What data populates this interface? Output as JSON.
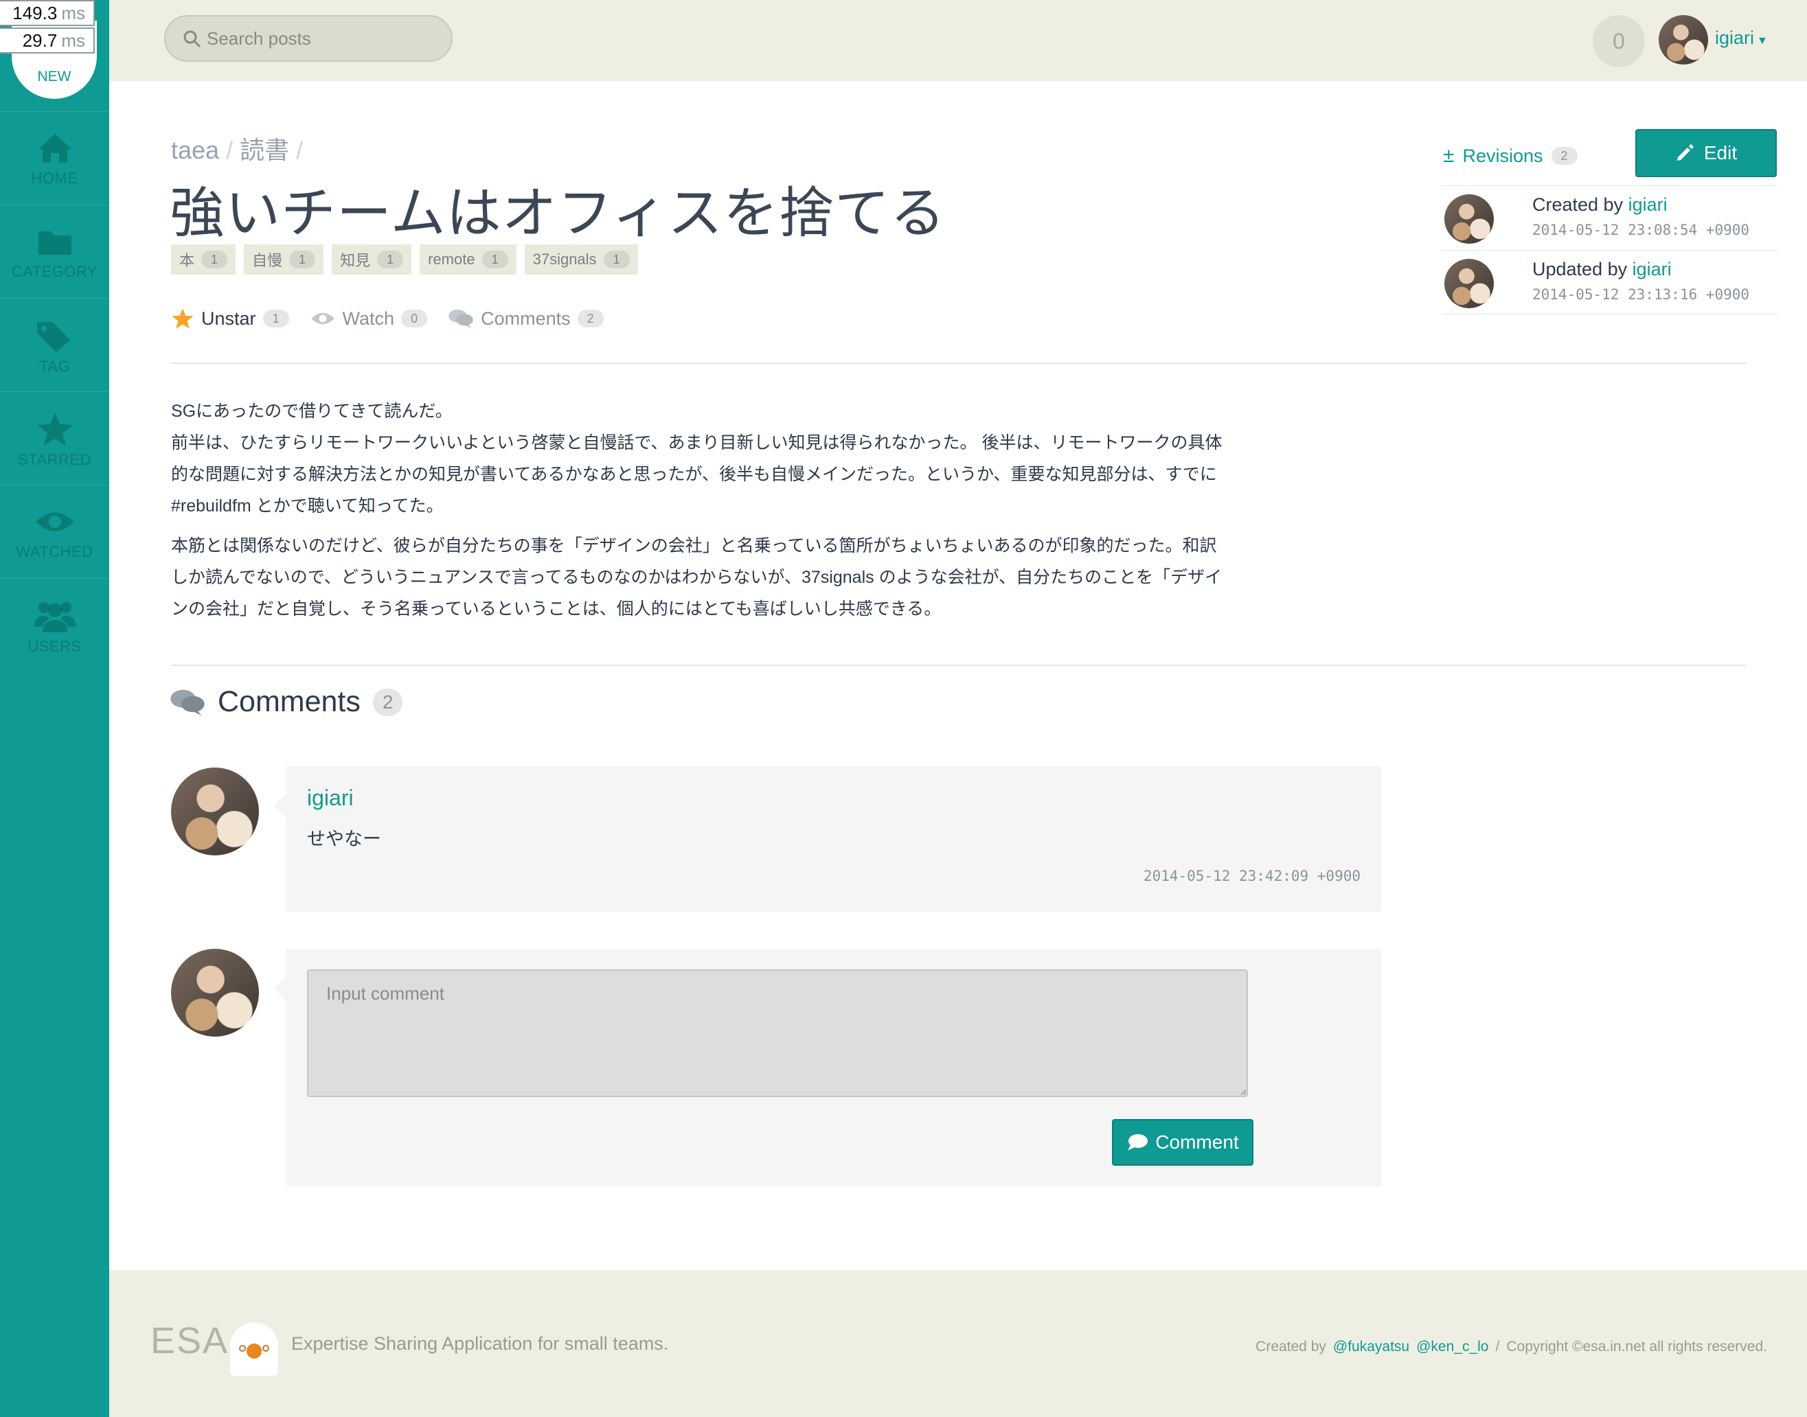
{
  "perf": {
    "top_value": "149.3",
    "bottom_value": "29.7",
    "unit": "ms"
  },
  "sidebar": {
    "new_label": "NEW",
    "items": [
      {
        "label": "HOME",
        "icon": "home-icon"
      },
      {
        "label": "CATEGORY",
        "icon": "folder-icon"
      },
      {
        "label": "TAG",
        "icon": "tags-icon"
      },
      {
        "label": "STARRED",
        "icon": "star-icon"
      },
      {
        "label": "WATCHED",
        "icon": "eye-icon"
      },
      {
        "label": "USERS",
        "icon": "users-icon"
      }
    ]
  },
  "header": {
    "search_placeholder": "Search posts",
    "notification_count": "0",
    "username": "igiari"
  },
  "post": {
    "breadcrumb": [
      "taea",
      "読書"
    ],
    "title": "強いチームはオフィスを捨てる",
    "tags": [
      {
        "name": "本",
        "count": "1"
      },
      {
        "name": "自慢",
        "count": "1"
      },
      {
        "name": "知見",
        "count": "1"
      },
      {
        "name": "remote",
        "count": "1"
      },
      {
        "name": "37signals",
        "count": "1"
      }
    ],
    "actions": {
      "unstar_label": "Unstar",
      "unstar_count": "1",
      "watch_label": "Watch",
      "watch_count": "0",
      "comments_label": "Comments",
      "comments_count": "2"
    },
    "body": {
      "p1_lines": [
        "SGにあったので借りてきて読んだ。",
        "前半は、ひたすらリモートワークいいよという啓蒙と自慢話で、あまり目新しい知見は得られなかった。 後半は、リモートワークの具体",
        "的な問題に対する解決方法とかの知見が書いてあるかなあと思ったが、後半も自慢メインだった。というか、重要な知見部分は、すでに",
        "#rebuildfm とかで聴いて知ってた。"
      ],
      "p2_lines": [
        "本筋とは関係ないのだけど、彼らが自分たちの事を「デザインの会社」と名乗っている箇所がちょいちょいあるのが印象的だった。和訳",
        "しか読んでないので、どういうニュアンスで言ってるものなのかはわからないが、37signals のような会社が、自分たちのことを「デザイ",
        "ンの会社」だと自覚し、そう名乗っているということは、個人的にはとても喜ばしいし共感できる。"
      ]
    }
  },
  "meta": {
    "revisions_label": "Revisions",
    "revisions_count": "2",
    "edit_label": "Edit",
    "created_prefix": "Created by",
    "created_user": "igiari",
    "created_at": "2014-05-12 23:08:54 +0900",
    "updated_prefix": "Updated by",
    "updated_user": "igiari",
    "updated_at": "2014-05-12 23:13:16 +0900"
  },
  "comments": {
    "heading": "Comments",
    "count": "2",
    "items": [
      {
        "author": "igiari",
        "text": "せやなー",
        "time": "2014-05-12 23:42:09 +0900"
      }
    ],
    "input_placeholder": "Input comment",
    "submit_label": "Comment"
  },
  "footer": {
    "logo": "ESA",
    "tagline": "Expertise Sharing Application for small teams.",
    "created_by": "Created by",
    "authors": [
      "@fukayatsu",
      "@ken_c_lo"
    ],
    "separator": "/",
    "copyright": "Copyright ©esa.in.net all rights reserved."
  },
  "colors": {
    "accent": "#0f9a93",
    "header_bg": "#efeee3",
    "star": "#f5a623"
  }
}
